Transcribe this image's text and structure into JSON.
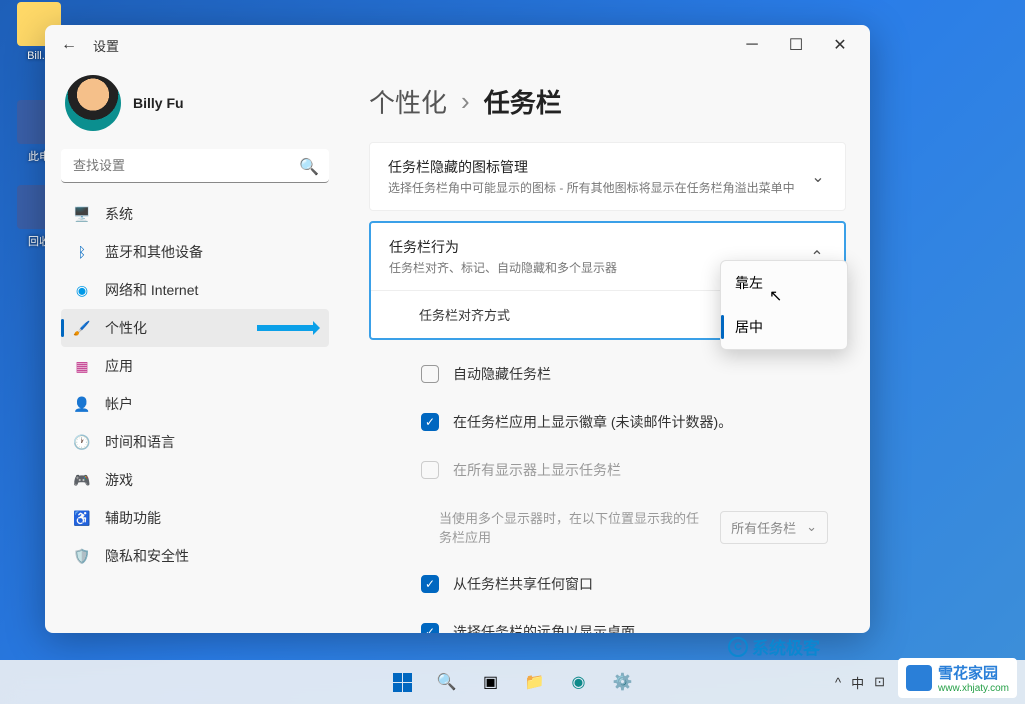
{
  "desktop": {
    "icon1": "Bill...",
    "icon2": "此电",
    "icon3": "回收"
  },
  "window": {
    "title": "设置",
    "profile": {
      "name": "Billy Fu",
      "email": ""
    },
    "search_placeholder": "查找设置",
    "nav": [
      {
        "label": "系统"
      },
      {
        "label": "蓝牙和其他设备"
      },
      {
        "label": "网络和 Internet"
      },
      {
        "label": "个性化"
      },
      {
        "label": "应用"
      },
      {
        "label": "帐户"
      },
      {
        "label": "时间和语言"
      },
      {
        "label": "游戏"
      },
      {
        "label": "辅助功能"
      },
      {
        "label": "隐私和安全性"
      }
    ],
    "breadcrumb": {
      "parent": "个性化",
      "current": "任务栏"
    },
    "group_hidden_icons": {
      "title": "任务栏隐藏的图标管理",
      "sub": "选择任务栏角中可能显示的图标 - 所有其他图标将显示在任务栏角溢出菜单中"
    },
    "group_behavior": {
      "title": "任务栏行为",
      "sub": "任务栏对齐、标记、自动隐藏和多个显示器",
      "alignment_label": "任务栏对齐方式",
      "dropdown_options": {
        "left": "靠左",
        "center": "居中"
      },
      "auto_hide": "自动隐藏任务栏",
      "badges": "在任务栏应用上显示徽章 (未读邮件计数器)。",
      "all_monitors": "在所有显示器上显示任务栏",
      "multi_monitor_label": "当使用多个显示器时，在以下位置显示我的任务栏应用",
      "multi_monitor_value": "所有任务栏",
      "share_window": "从任务栏共享任何窗口",
      "far_corner": "选择任务栏的远角以显示桌面"
    }
  },
  "taskbar_tray": {
    "chevron": "^",
    "ime": "中",
    "battery_wifi": "⊡"
  },
  "watermark1": "系统极客",
  "watermark2": {
    "name": "雪花家园",
    "url": "www.xhjaty.com"
  }
}
